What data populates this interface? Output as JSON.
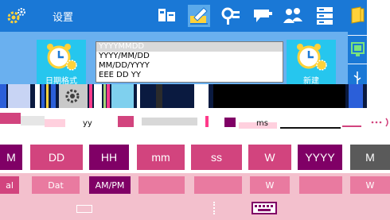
{
  "header": {
    "title": "设置"
  },
  "panel": {
    "left_button_label": "日期格式",
    "right_button_label": "新建",
    "formats": [
      "YYYYMMDD",
      "YYYY/MM/DD",
      "MM/DD/YYYY",
      "EEE DD YY"
    ],
    "selected_format": "YYYYMMDD"
  },
  "glitch": {
    "text_a": "yy",
    "text_b": "ms"
  },
  "components": {
    "tabs": [
      "M",
      "DD",
      "HH",
      "mm",
      "ss",
      "W",
      "YYYY",
      "M"
    ],
    "values": [
      "al",
      "Dat",
      "AM/PM",
      "",
      "",
      "W",
      "",
      "W"
    ]
  },
  "colors": {
    "titlebar": "#1a78d6",
    "panel": "#6ab0ef",
    "button": "#26c6ee",
    "tab_dark": "#800066",
    "tab_light": "#d2447e",
    "tab_gray": "#5a5a5a",
    "value_row": "#f3c0cd"
  },
  "icons": [
    "gear-icon",
    "device-icon",
    "edit-icon",
    "chip-icon",
    "projector-icon",
    "users-icon",
    "server-icon",
    "folder-icon",
    "monitor-icon",
    "usb-icon",
    "alarm-clock-icon",
    "alarm-settings-icon",
    "ellipsis-icon"
  ]
}
